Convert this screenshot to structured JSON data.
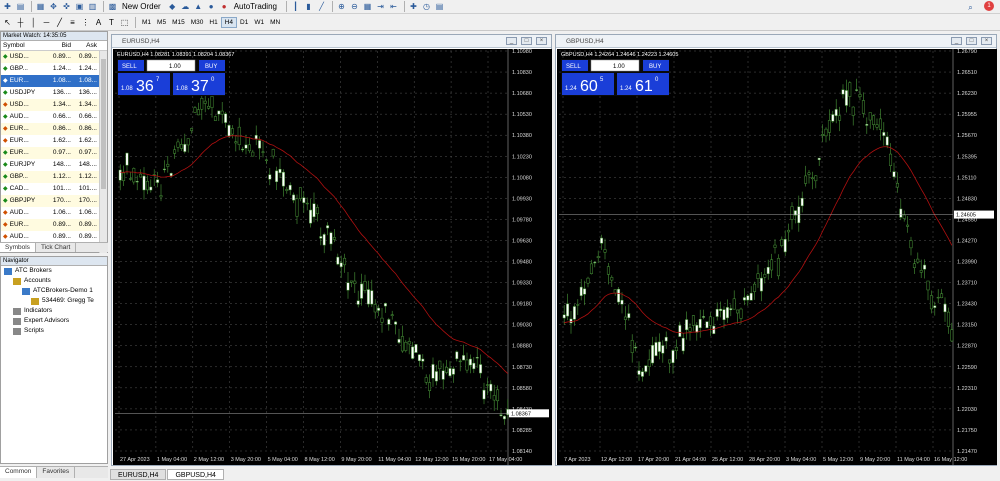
{
  "toolbar": {
    "new_order": "New Order",
    "autotrading": "AutoTrading",
    "notif_count": "1"
  },
  "timeframes": [
    {
      "label": "M1"
    },
    {
      "label": "M5"
    },
    {
      "label": "M15"
    },
    {
      "label": "M30"
    },
    {
      "label": "H1"
    },
    {
      "label": "H4",
      "active": true
    },
    {
      "label": "D1"
    },
    {
      "label": "W1"
    },
    {
      "label": "MN"
    }
  ],
  "market_watch": {
    "title": "Market Watch: 14:35:05",
    "headers": {
      "symbol": "Symbol",
      "bid": "Bid",
      "ask": "Ask"
    },
    "rows": [
      {
        "symbol": "USD...",
        "bid": "0.89...",
        "ask": "0.89...",
        "dir": "up"
      },
      {
        "symbol": "GBP...",
        "bid": "1.24...",
        "ask": "1.24...",
        "dir": "up"
      },
      {
        "symbol": "EUR...",
        "bid": "1.08...",
        "ask": "1.08...",
        "dir": "up",
        "selected": true
      },
      {
        "symbol": "USDJPY",
        "bid": "136....",
        "ask": "136....",
        "dir": "up"
      },
      {
        "symbol": "USD...",
        "bid": "1.34...",
        "ask": "1.34...",
        "dir": "dn"
      },
      {
        "symbol": "AUD...",
        "bid": "0.66...",
        "ask": "0.66...",
        "dir": "up"
      },
      {
        "symbol": "EUR...",
        "bid": "0.86...",
        "ask": "0.86...",
        "dir": "dn"
      },
      {
        "symbol": "EUR...",
        "bid": "1.62...",
        "ask": "1.62...",
        "dir": "dn"
      },
      {
        "symbol": "EUR...",
        "bid": "0.97...",
        "ask": "0.97...",
        "dir": "up"
      },
      {
        "symbol": "EURJPY",
        "bid": "148....",
        "ask": "148....",
        "dir": "up"
      },
      {
        "symbol": "GBP...",
        "bid": "1.12...",
        "ask": "1.12...",
        "dir": "up"
      },
      {
        "symbol": "CAD...",
        "bid": "101....",
        "ask": "101....",
        "dir": "up"
      },
      {
        "symbol": "GBPJPY",
        "bid": "170....",
        "ask": "170....",
        "dir": "up"
      },
      {
        "symbol": "AUD...",
        "bid": "1.06...",
        "ask": "1.06...",
        "dir": "dn"
      },
      {
        "symbol": "EUR...",
        "bid": "0.89...",
        "ask": "0.89...",
        "dir": "dn"
      },
      {
        "symbol": "AUD...",
        "bid": "0.89...",
        "ask": "0.89...",
        "dir": "dn"
      }
    ],
    "tabs": [
      "Symbols",
      "Tick Chart"
    ]
  },
  "navigator": {
    "title": "Navigator",
    "items": [
      {
        "label": "ATC Brokers",
        "level": 0
      },
      {
        "label": "Accounts",
        "level": 1
      },
      {
        "label": "ATCBrokers-Demo 1",
        "level": 2
      },
      {
        "label": "534469: Gregg Te",
        "level": 3
      },
      {
        "label": "Indicators",
        "level": 1
      },
      {
        "label": "Expert Advisors",
        "level": 1
      },
      {
        "label": "Scripts",
        "level": 1
      }
    ],
    "tabs": [
      "Common",
      "Favorites"
    ]
  },
  "charts": [
    {
      "title": "EURUSD,H4",
      "info": "EURUSD,H4  1.08281 1.08391 1.08204 1.08367",
      "sell": "SELL",
      "buy": "BUY",
      "lot": "1.00",
      "sell_price": {
        "pre": "1.08",
        "big": "36",
        "sup": "7"
      },
      "buy_price": {
        "pre": "1.08",
        "big": "37",
        "sup": "0"
      },
      "current": "1.08367",
      "current_val": 1.08367,
      "ylabels": [
        "1.10980",
        "1.10830",
        "1.10680",
        "1.10530",
        "1.10380",
        "1.10230",
        "1.10080",
        "1.09930",
        "1.09780",
        "1.09630",
        "1.09480",
        "1.09330",
        "1.09180",
        "1.09030",
        "1.08880",
        "1.08730",
        "1.08580",
        "1.08430",
        "1.08285",
        "1.08140"
      ],
      "ymax": 1.1103,
      "ymin": 1.0809,
      "xlabels": [
        "27 Apr 2023",
        "1 May 04:00",
        "2 May 12:00",
        "3 May 20:00",
        "5 May 04:00",
        "8 May 12:00",
        "9 May 20:00",
        "11 May 04:00",
        "12 May 12:00",
        "15 May 20:00",
        "17 May 04:00"
      ]
    },
    {
      "title": "GBPUSD,H4",
      "info": "GBPUSD,H4  1.24264 1.24646 1.24223 1.24605",
      "sell": "SELL",
      "buy": "BUY",
      "lot": "1.00",
      "sell_price": {
        "pre": "1.24",
        "big": "60",
        "sup": "5"
      },
      "buy_price": {
        "pre": "1.24",
        "big": "61",
        "sup": "0"
      },
      "current": "1.24605",
      "current_val": 1.24605,
      "ylabels": [
        "1.26790",
        "1.26510",
        "1.26230",
        "1.25955",
        "1.25670",
        "1.25395",
        "1.25110",
        "1.24830",
        "1.24550",
        "1.24270",
        "1.23990",
        "1.23710",
        "1.23430",
        "1.23150",
        "1.22870",
        "1.22590",
        "1.22310",
        "1.22030",
        "1.21750",
        "1.21470"
      ],
      "ymax": 1.2685,
      "ymin": 1.2136,
      "xlabels": [
        "7 Apr 2023",
        "12 Apr 12:00",
        "17 Apr 20:00",
        "21 Apr 04:00",
        "25 Apr 12:00",
        "28 Apr 20:00",
        "3 May 04:00",
        "5 May 12:00",
        "9 May 20:00",
        "11 May 04:00",
        "16 May 12:00"
      ]
    }
  ],
  "bottom_tabs": [
    "EURUSD,H4",
    "GBPUSD,H4"
  ],
  "colors": {
    "up": "#1a8a1a",
    "down": "#d05000",
    "candle": "#4a9a3a",
    "ma": "#b01010",
    "buy_sell_bg": "#1a3ed8"
  }
}
